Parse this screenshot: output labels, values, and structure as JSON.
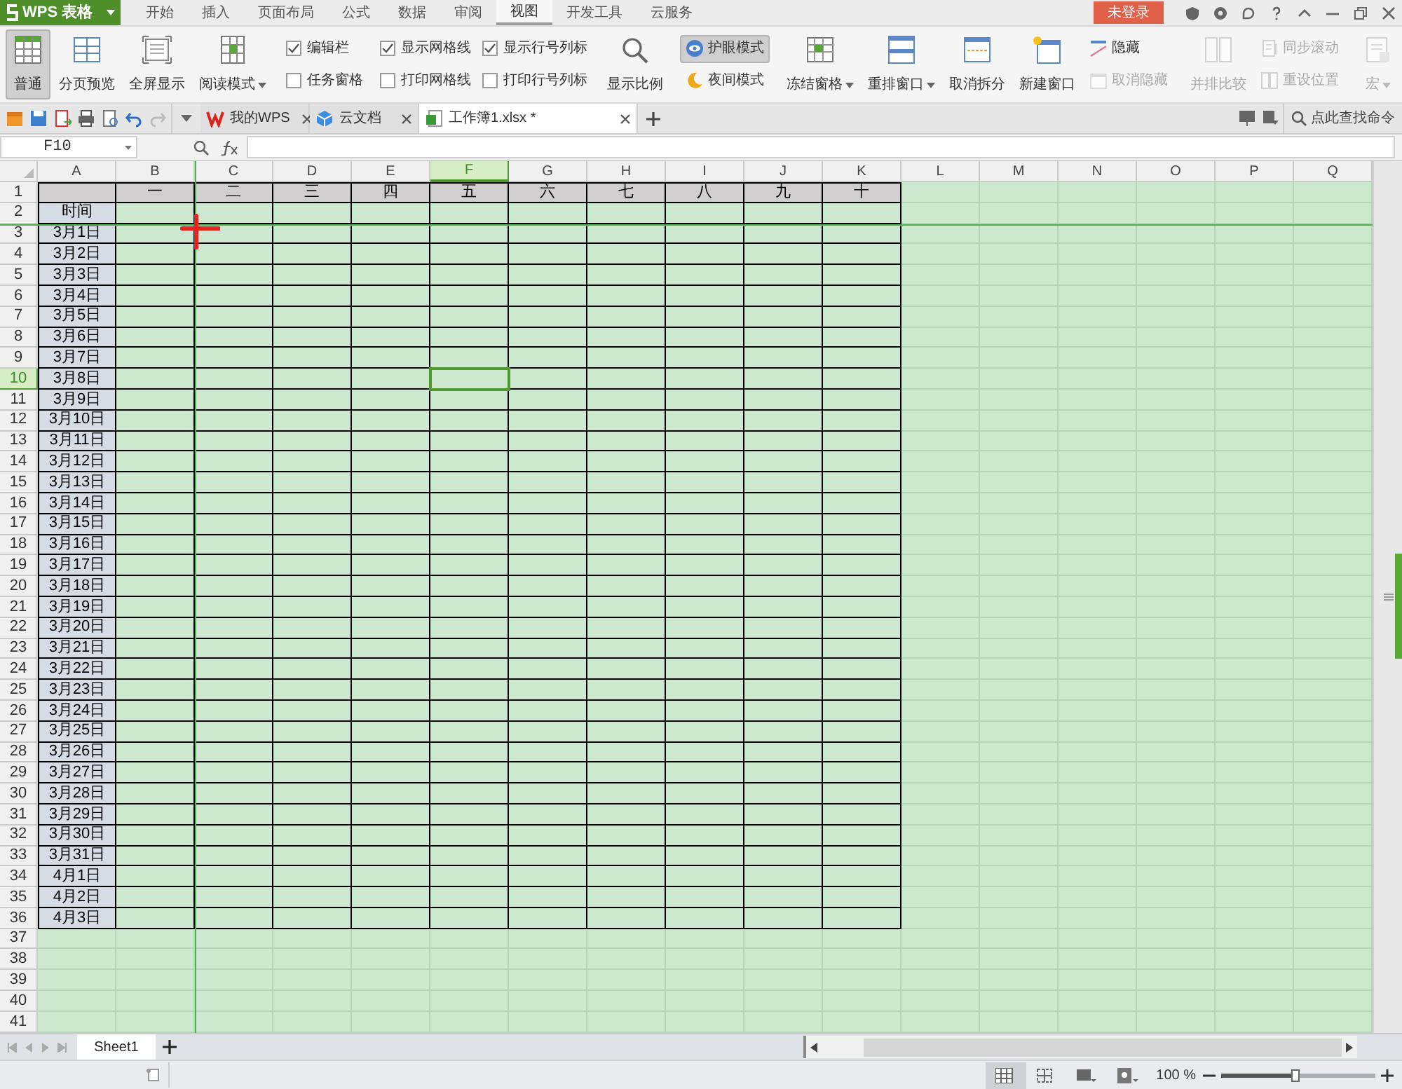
{
  "app": {
    "title": "WPS 表格"
  },
  "menu_tabs": [
    {
      "label": "开始",
      "selected": false
    },
    {
      "label": "插入",
      "selected": false
    },
    {
      "label": "页面布局",
      "selected": false
    },
    {
      "label": "公式",
      "selected": false
    },
    {
      "label": "数据",
      "selected": false
    },
    {
      "label": "审阅",
      "selected": false
    },
    {
      "label": "视图",
      "selected": true
    },
    {
      "label": "开发工具",
      "selected": false
    },
    {
      "label": "云服务",
      "selected": false
    }
  ],
  "login_button": "未登录",
  "ribbon": {
    "groups": [
      {
        "items": [
          {
            "kind": "large",
            "label": "普通",
            "selected": true,
            "disabled": false,
            "dropdown": false
          },
          {
            "kind": "large",
            "label": "分页预览",
            "selected": false,
            "disabled": false,
            "dropdown": false
          },
          {
            "kind": "large",
            "label": "全屏显示",
            "selected": false,
            "disabled": false,
            "dropdown": false
          },
          {
            "kind": "large",
            "label": "阅读模式",
            "selected": false,
            "disabled": false,
            "dropdown": true
          }
        ]
      },
      {
        "items": [
          {
            "kind": "check",
            "label": "编辑栏",
            "checked": true
          },
          {
            "kind": "check",
            "label": "任务窗格",
            "checked": false
          }
        ]
      },
      {
        "items": [
          {
            "kind": "check",
            "label": "显示网格线",
            "checked": true
          },
          {
            "kind": "check",
            "label": "打印网格线",
            "checked": false
          },
          {
            "kind": "check",
            "label": "显示行号列标",
            "checked": true
          },
          {
            "kind": "check",
            "label": "打印行号列标",
            "checked": false
          }
        ]
      },
      {
        "items": [
          {
            "kind": "large",
            "label": "显示比例",
            "selected": false,
            "disabled": false,
            "dropdown": false
          }
        ]
      },
      {
        "items": [
          {
            "kind": "small",
            "label": "护眼模式",
            "selected": true,
            "disabled": false,
            "dropdown": false
          },
          {
            "kind": "small",
            "label": "夜间模式",
            "selected": false,
            "disabled": false,
            "dropdown": false
          }
        ]
      },
      {
        "items": [
          {
            "kind": "large",
            "label": "冻结窗格",
            "selected": false,
            "disabled": false,
            "dropdown": true
          },
          {
            "kind": "large",
            "label": "重排窗口",
            "selected": false,
            "disabled": false,
            "dropdown": true
          },
          {
            "kind": "large",
            "label": "取消拆分",
            "selected": false,
            "disabled": false,
            "dropdown": false
          },
          {
            "kind": "large",
            "label": "新建窗口",
            "selected": false,
            "disabled": false,
            "dropdown": false
          },
          {
            "kind": "small",
            "label": "隐藏",
            "selected": false,
            "disabled": false,
            "dropdown": false
          },
          {
            "kind": "small",
            "label": "取消隐藏",
            "selected": false,
            "disabled": true,
            "dropdown": false
          }
        ]
      },
      {
        "items": [
          {
            "kind": "large",
            "label": "并排比较",
            "selected": false,
            "disabled": true,
            "dropdown": false
          },
          {
            "kind": "small",
            "label": "同步滚动",
            "selected": false,
            "disabled": true,
            "dropdown": false
          },
          {
            "kind": "small",
            "label": "重设位置",
            "selected": false,
            "disabled": true,
            "dropdown": false
          }
        ]
      },
      {
        "items": [
          {
            "kind": "large",
            "label": "宏",
            "selected": false,
            "disabled": true,
            "dropdown": true
          }
        ]
      }
    ]
  },
  "document_tabs": [
    {
      "kind": "home",
      "label": "我的WPS",
      "selected": false
    },
    {
      "kind": "cloud",
      "label": "云文档",
      "selected": false
    },
    {
      "kind": "workbook",
      "label": "工作簿1.xlsx *",
      "selected": true
    }
  ],
  "command_search": {
    "placeholder": "点此查找命令"
  },
  "formula_bar": {
    "name_box": "F10"
  },
  "sheet": {
    "columns": [
      {
        "label": "A",
        "selected": false
      },
      {
        "label": "B",
        "selected": false
      },
      {
        "label": "C",
        "selected": false
      },
      {
        "label": "D",
        "selected": false
      },
      {
        "label": "E",
        "selected": false
      },
      {
        "label": "F",
        "selected": true
      },
      {
        "label": "G",
        "selected": false
      },
      {
        "label": "H",
        "selected": false
      },
      {
        "label": "I",
        "selected": false
      },
      {
        "label": "J",
        "selected": false
      },
      {
        "label": "K",
        "selected": false
      },
      {
        "label": "L",
        "selected": false
      },
      {
        "label": "M",
        "selected": false
      },
      {
        "label": "N",
        "selected": false
      },
      {
        "label": "O",
        "selected": false
      },
      {
        "label": "P",
        "selected": false
      },
      {
        "label": "Q",
        "selected": false
      }
    ],
    "rows": [
      {
        "label": "1",
        "selected": false
      },
      {
        "label": "2",
        "selected": false
      },
      {
        "label": "3",
        "selected": false
      },
      {
        "label": "4",
        "selected": false
      },
      {
        "label": "5",
        "selected": false
      },
      {
        "label": "6",
        "selected": false
      },
      {
        "label": "7",
        "selected": false
      },
      {
        "label": "8",
        "selected": false
      },
      {
        "label": "9",
        "selected": false
      },
      {
        "label": "10",
        "selected": true
      },
      {
        "label": "11",
        "selected": false
      },
      {
        "label": "12",
        "selected": false
      },
      {
        "label": "13",
        "selected": false
      },
      {
        "label": "14",
        "selected": false
      },
      {
        "label": "15",
        "selected": false
      },
      {
        "label": "16",
        "selected": false
      },
      {
        "label": "17",
        "selected": false
      },
      {
        "label": "18",
        "selected": false
      },
      {
        "label": "19",
        "selected": false
      },
      {
        "label": "20",
        "selected": false
      },
      {
        "label": "21",
        "selected": false
      },
      {
        "label": "22",
        "selected": false
      },
      {
        "label": "23",
        "selected": false
      },
      {
        "label": "24",
        "selected": false
      },
      {
        "label": "25",
        "selected": false
      },
      {
        "label": "26",
        "selected": false
      },
      {
        "label": "27",
        "selected": false
      },
      {
        "label": "28",
        "selected": false
      },
      {
        "label": "29",
        "selected": false
      },
      {
        "label": "30",
        "selected": false
      },
      {
        "label": "31",
        "selected": false
      },
      {
        "label": "32",
        "selected": false
      },
      {
        "label": "33",
        "selected": false
      },
      {
        "label": "34",
        "selected": false
      },
      {
        "label": "35",
        "selected": false
      },
      {
        "label": "36",
        "selected": false
      },
      {
        "label": "37",
        "selected": false
      },
      {
        "label": "38",
        "selected": false
      },
      {
        "label": "39",
        "selected": false
      },
      {
        "label": "40",
        "selected": false
      },
      {
        "label": "41",
        "selected": false
      }
    ]
  },
  "table": {
    "column_titles": [
      "一",
      "二",
      "三",
      "四",
      "五",
      "六",
      "七",
      "八",
      "九",
      "十"
    ],
    "row_title": "时间",
    "row_labels": [
      "3月1日",
      "3月2日",
      "3月3日",
      "3月4日",
      "3月5日",
      "3月6日",
      "3月7日",
      "3月8日",
      "3月9日",
      "3月10日",
      "3月11日",
      "3月12日",
      "3月13日",
      "3月14日",
      "3月15日",
      "3月16日",
      "3月17日",
      "3月18日",
      "3月19日",
      "3月20日",
      "3月21日",
      "3月22日",
      "3月23日",
      "3月24日",
      "3月25日",
      "3月26日",
      "3月27日",
      "3月28日",
      "3月29日",
      "3月30日",
      "3月31日",
      "4月1日",
      "4月2日",
      "4月3日"
    ]
  },
  "sheet_tabs": [
    {
      "label": "Sheet1",
      "selected": true
    }
  ],
  "status_bar": {
    "zoom_text": "100 %",
    "zoom": {
      "level": 0.48
    }
  }
}
